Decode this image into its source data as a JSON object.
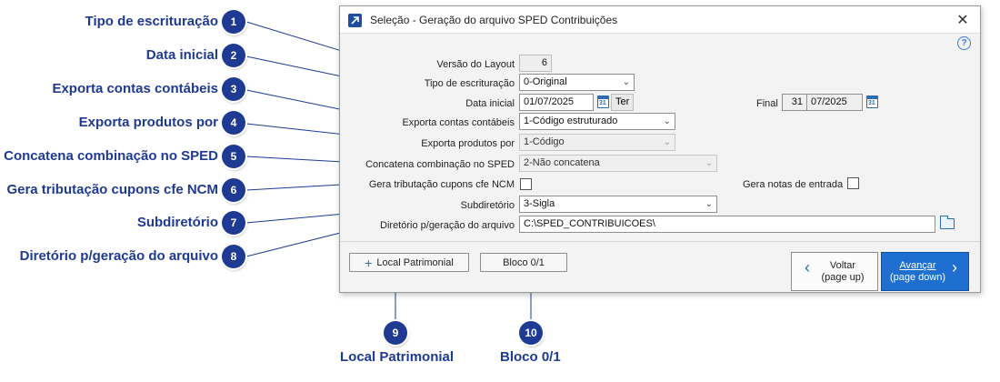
{
  "callouts": [
    {
      "num": "1",
      "label": "Tipo de escrituração"
    },
    {
      "num": "2",
      "label": "Data inicial"
    },
    {
      "num": "3",
      "label": "Exporta contas contábeis"
    },
    {
      "num": "4",
      "label": "Exporta produtos por"
    },
    {
      "num": "5",
      "label": "Concatena combinação no SPED"
    },
    {
      "num": "6",
      "label": "Gera tributação cupons cfe NCM"
    },
    {
      "num": "7",
      "label": "Subdiretório"
    },
    {
      "num": "8",
      "label": "Diretório p/geração do arquivo"
    },
    {
      "num": "9",
      "label": "Local Patrimonial"
    },
    {
      "num": "10",
      "label": "Bloco 0/1"
    }
  ],
  "window": {
    "title": "Seleção - Geração do arquivo SPED Contribuições",
    "close": "✕",
    "help": "?"
  },
  "form": {
    "versao": {
      "label": "Versão do Layout",
      "value": "6"
    },
    "tipo": {
      "label": "Tipo de escrituração",
      "value": "0-Original"
    },
    "data_inicial": {
      "label": "Data inicial",
      "value": "01/07/2025",
      "weekday": "Ter"
    },
    "final": {
      "label": "Final",
      "day": "31",
      "value": "07/2025"
    },
    "contas": {
      "label": "Exporta contas contábeis",
      "value": "1-Código estruturado"
    },
    "produtos": {
      "label": "Exporta produtos por",
      "value": "1-Código"
    },
    "concatena": {
      "label": "Concatena combinação no SPED",
      "value": "2-Não concatena"
    },
    "tributacao": {
      "label": "Gera tributação cupons cfe NCM"
    },
    "notas_entrada": {
      "label": "Gera notas de entrada"
    },
    "subdiretorio": {
      "label": "Subdiretório",
      "value": "3-Sigla"
    },
    "diretorio": {
      "label": "Diretório p/geração do arquivo",
      "value": "C:\\SPED_CONTRIBUICOES\\"
    }
  },
  "buttons": {
    "local_patrimonial": "Local Patrimonial",
    "local_icon": "+",
    "bloco": "Bloco 0/1",
    "voltar_line1": "Voltar",
    "voltar_line2": "(page up)",
    "avancar_line1": "Avançar",
    "avancar_line2": "(page down)",
    "chevron_left": "‹",
    "chevron_right": "›"
  },
  "colors": {
    "accent": "#1f3a93",
    "primary_button": "#1f6fd1"
  }
}
